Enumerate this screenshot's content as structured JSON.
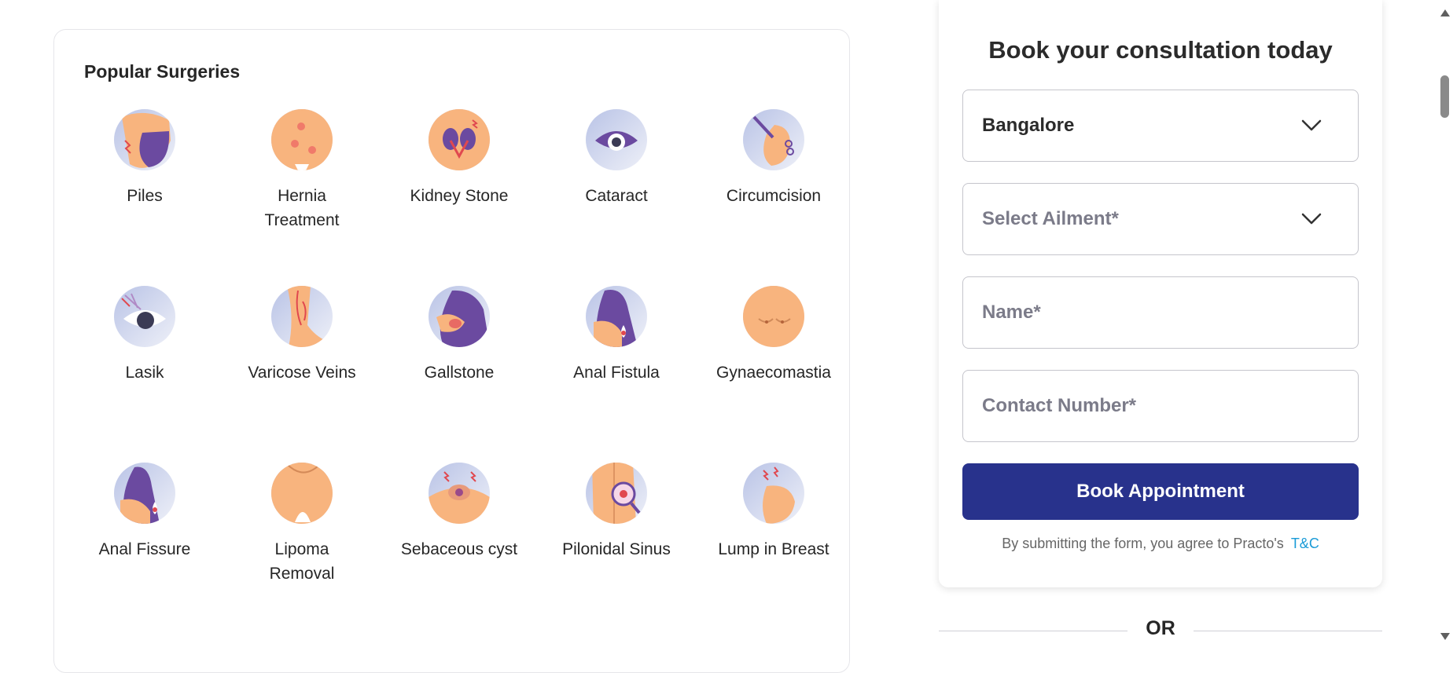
{
  "surgeries": {
    "title": "Popular Surgeries",
    "items": [
      {
        "label": "Piles",
        "icon": "piles-icon"
      },
      {
        "label": "Hernia Treatment",
        "icon": "hernia-icon"
      },
      {
        "label": "Kidney Stone",
        "icon": "kidney-stone-icon"
      },
      {
        "label": "Cataract",
        "icon": "cataract-icon"
      },
      {
        "label": "Circumcision",
        "icon": "circumcision-icon"
      },
      {
        "label": "Lasik",
        "icon": "lasik-icon"
      },
      {
        "label": "Varicose Veins",
        "icon": "varicose-veins-icon"
      },
      {
        "label": "Gallstone",
        "icon": "gallstone-icon"
      },
      {
        "label": "Anal Fistula",
        "icon": "anal-fistula-icon"
      },
      {
        "label": "Gynaecomastia",
        "icon": "gynaecomastia-icon"
      },
      {
        "label": "Anal Fissure",
        "icon": "anal-fissure-icon"
      },
      {
        "label": "Lipoma Removal",
        "icon": "lipoma-icon"
      },
      {
        "label": "Sebaceous cyst",
        "icon": "sebaceous-cyst-icon"
      },
      {
        "label": "Pilonidal Sinus",
        "icon": "pilonidal-sinus-icon"
      },
      {
        "label": "Lump in Breast",
        "icon": "breast-lump-icon"
      }
    ]
  },
  "booking": {
    "title": "Book your consultation today",
    "city_value": "Bangalore",
    "ailment_placeholder": "Select Ailment*",
    "name_placeholder": "Name*",
    "contact_placeholder": "Contact Number*",
    "button_label": "Book Appointment",
    "terms_text": "By submitting the form, you agree to Practo's",
    "terms_link": "T&C"
  },
  "or_text": "OR",
  "colors": {
    "brand_button": "#28328c",
    "link": "#1a9bd7",
    "icon_skin": "#f8b47e",
    "icon_purple": "#6b4aa0",
    "icon_bg": "#d6dcef"
  }
}
